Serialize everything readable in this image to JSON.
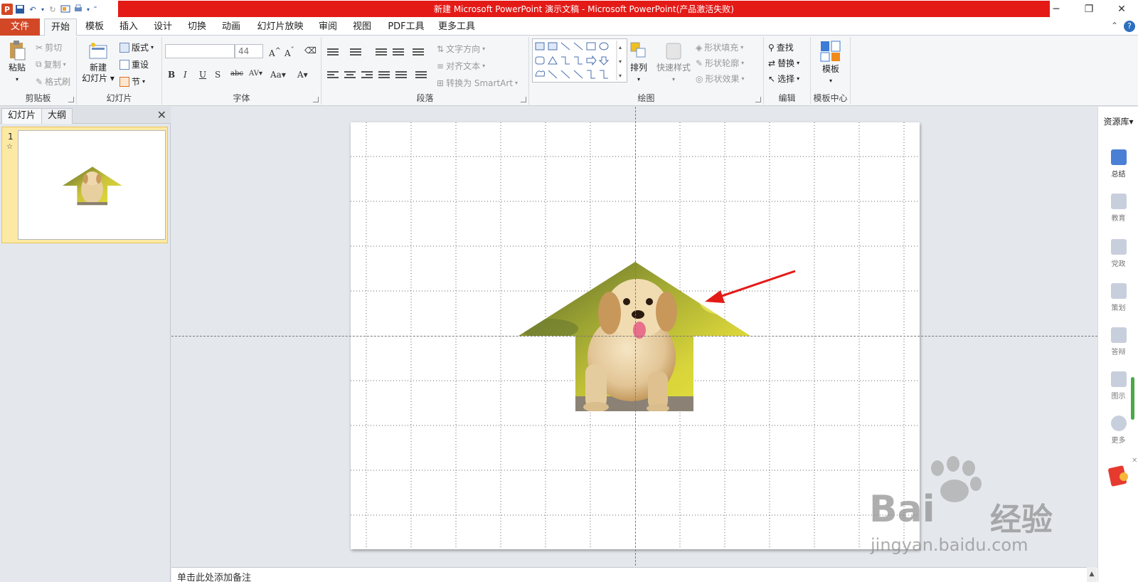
{
  "window": {
    "app_icon": "P",
    "title": "新建 Microsoft PowerPoint 演示文稿 - Microsoft PowerPoint(产品激活失败)"
  },
  "tabs": {
    "file": "文件",
    "items": [
      "开始",
      "模板",
      "插入",
      "设计",
      "切换",
      "动画",
      "幻灯片放映",
      "审阅",
      "视图",
      "PDF工具",
      "更多工具"
    ],
    "active": "开始"
  },
  "ribbon": {
    "clipboard": {
      "label": "剪贴板",
      "paste": "粘贴",
      "cut": "剪切",
      "copy": "复制",
      "format_painter": "格式刷"
    },
    "slides": {
      "label": "幻灯片",
      "new_slide_1": "新建",
      "new_slide_2": "幻灯片",
      "layout": "版式",
      "reset": "重设",
      "section": "节"
    },
    "font": {
      "label": "字体",
      "font_name": "",
      "font_size": "44"
    },
    "paragraph": {
      "label": "段落",
      "text_direction": "文字方向",
      "align_text": "对齐文本",
      "smartart": "转换为 SmartArt"
    },
    "drawing": {
      "label": "绘图",
      "arrange": "排列",
      "quick_styles": "快速样式",
      "shape_fill": "形状填充",
      "shape_outline": "形状轮廓",
      "shape_effects": "形状效果"
    },
    "editing": {
      "label": "编辑",
      "find": "查找",
      "replace": "替换",
      "select": "选择"
    },
    "template": {
      "label": "模板中心",
      "template": "模板"
    }
  },
  "left_pane": {
    "tab_slides": "幻灯片",
    "tab_outline": "大纲",
    "slide_number": "1"
  },
  "notes": {
    "placeholder": "单击此处添加备注"
  },
  "right_panel": {
    "title": "资源库",
    "items": [
      "总结",
      "教育",
      "党政",
      "策划",
      "答辩",
      "图示",
      "更多"
    ]
  },
  "watermark": {
    "line1": "Bai",
    "line2": "经验",
    "line3": "jingyan.baidu.com"
  },
  "colors": {
    "title_bar": "#e41a17",
    "file_tab": "#d24726",
    "arrow_annotation": "#e41a17",
    "thumb_highlight": "#fce9a4"
  }
}
